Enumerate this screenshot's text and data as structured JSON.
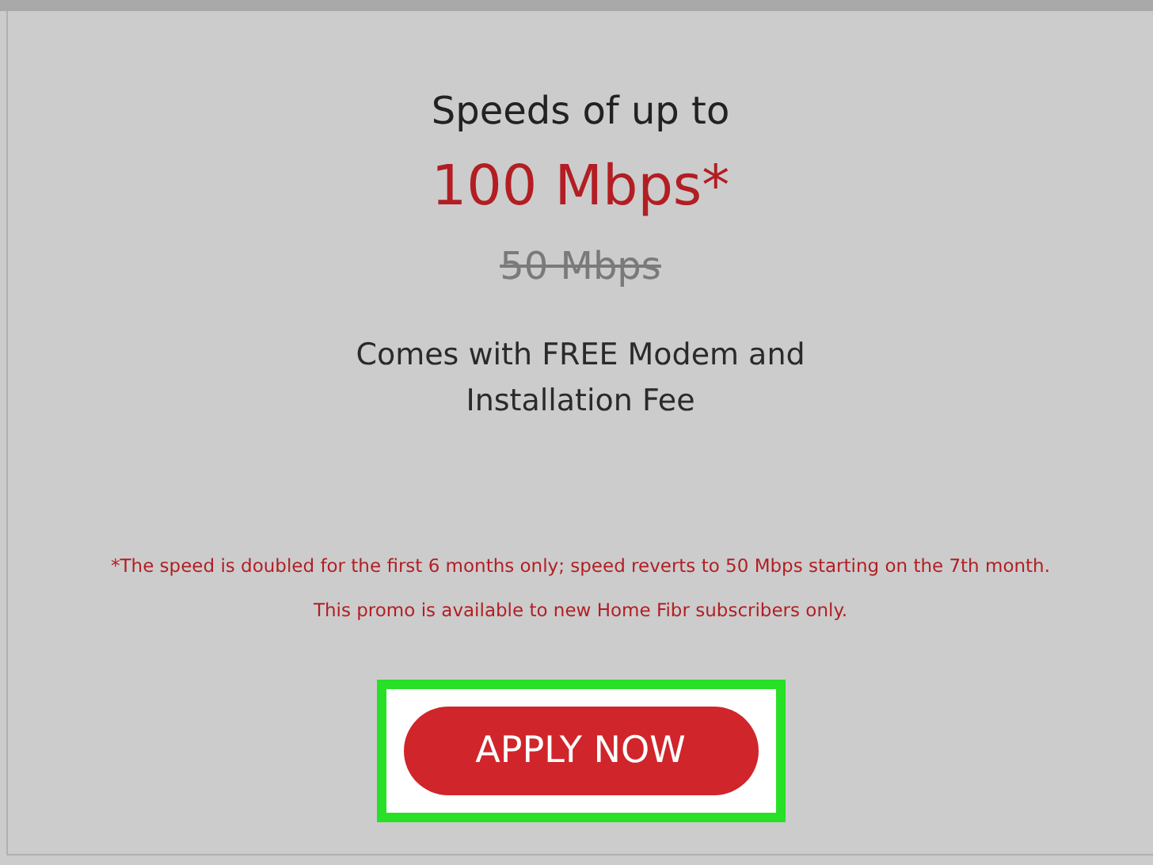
{
  "offer": {
    "intro": "Speeds of up to",
    "speed": "100 Mbps*",
    "old_speed": "50 Mbps",
    "perk": "Comes with FREE Modem and Installation Fee",
    "notes": [
      "*The speed is doubled for the first 6 months only; speed reverts to 50 Mbps starting on the 7th month.",
      "This promo is available to new Home Fibr subscribers only."
    ],
    "button": {
      "label": "APPLY NOW",
      "highlighted": true
    }
  }
}
